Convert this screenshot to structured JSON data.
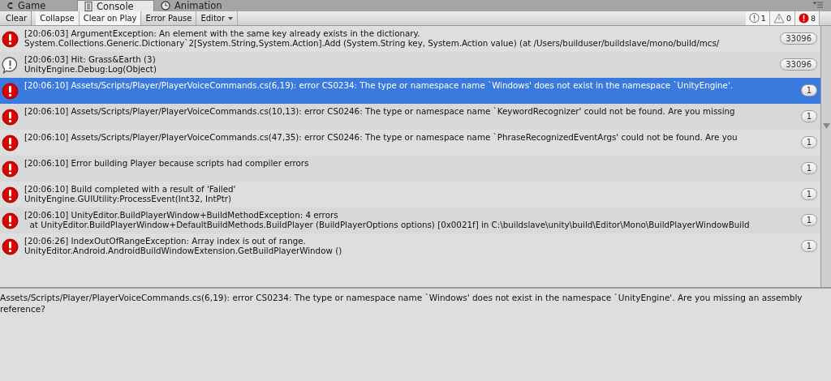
{
  "tabs": [
    {
      "label": "Game",
      "selected": false
    },
    {
      "label": "Console",
      "selected": true
    },
    {
      "label": "Animation",
      "selected": false
    }
  ],
  "toolbar": [
    {
      "label": "Clear",
      "kind": "button",
      "on": false
    },
    {
      "label": "Collapse",
      "kind": "button",
      "on": true
    },
    {
      "label": "Clear on Play",
      "kind": "button",
      "on": true
    },
    {
      "label": "Error Pause",
      "kind": "button",
      "on": false
    },
    {
      "label": "Editor",
      "kind": "dropdown"
    }
  ],
  "counters": [
    {
      "kind": "info",
      "count": "1"
    },
    {
      "kind": "warning",
      "count": "0"
    },
    {
      "kind": "error",
      "count": "8"
    }
  ],
  "entries": [
    {
      "kind": "error",
      "selected": false,
      "lines": [
        "[20:06:03] ArgumentException: An element with the same key already exists in the dictionary.",
        "System.Collections.Generic.Dictionary`2[System.String,System.Action].Add (System.String key, System.Action value) (at /Users/builduser/buildslave/mono/build/mcs/"
      ],
      "count": "33096"
    },
    {
      "kind": "info",
      "selected": false,
      "lines": [
        "[20:06:03] Hit: Grass&Earth (3)",
        "UnityEngine.Debug:Log(Object)"
      ],
      "count": "33096"
    },
    {
      "kind": "error",
      "selected": true,
      "lines": [
        "[20:06:10] Assets/Scripts/Player/PlayerVoiceCommands.cs(6,19): error CS0234: The type or namespace name `Windows' does not exist in the namespace `UnityEngine'."
      ],
      "count": "1"
    },
    {
      "kind": "error",
      "selected": false,
      "lines": [
        "[20:06:10] Assets/Scripts/Player/PlayerVoiceCommands.cs(10,13): error CS0246: The type or namespace name `KeywordRecognizer' could not be found. Are you missing"
      ],
      "count": "1"
    },
    {
      "kind": "error",
      "selected": false,
      "lines": [
        "[20:06:10] Assets/Scripts/Player/PlayerVoiceCommands.cs(47,35): error CS0246: The type or namespace name `PhraseRecognizedEventArgs' could not be found. Are you"
      ],
      "count": "1"
    },
    {
      "kind": "error",
      "selected": false,
      "lines": [
        "[20:06:10] Error building Player because scripts had compiler errors"
      ],
      "count": "1"
    },
    {
      "kind": "error",
      "selected": false,
      "lines": [
        "[20:06:10] Build completed with a result of 'Failed'",
        "UnityEngine.GUIUtility:ProcessEvent(Int32, IntPtr)"
      ],
      "count": "1"
    },
    {
      "kind": "error",
      "selected": false,
      "lines": [
        "[20:06:10] UnityEditor.BuildPlayerWindow+BuildMethodException: 4 errors",
        "  at UnityEditor.BuildPlayerWindow+DefaultBuildMethods.BuildPlayer (BuildPlayerOptions options) [0x0021f] in C:\\buildslave\\unity\\build\\Editor\\Mono\\BuildPlayerWindowBuild"
      ],
      "count": "1"
    },
    {
      "kind": "error",
      "selected": false,
      "lines": [
        "[20:06:26] IndexOutOfRangeException: Array index is out of range.",
        "UnityEditor.Android.AndroidBuildWindowExtension.GetBuildPlayerWindow ()"
      ],
      "count": "1"
    }
  ],
  "detail": "Assets/Scripts/Player/PlayerVoiceCommands.cs(6,19): error CS0234: The type or namespace name `Windows' does not exist in the namespace `UnityEngine'. Are you missing an assembly reference?"
}
